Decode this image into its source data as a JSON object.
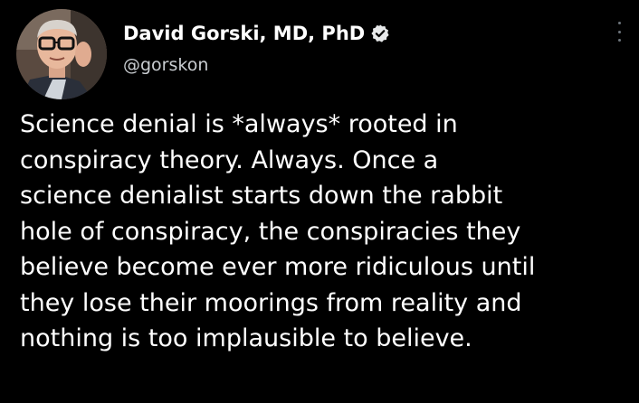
{
  "author": {
    "display_name": "David Gorski, MD, PhD",
    "handle": "@gorskon",
    "verified_icon": "verified-badge-icon",
    "avatar_icon": "profile-photo"
  },
  "menu": {
    "more_icon": "more-vertical-icon"
  },
  "tweet": {
    "lines": [
      "Science denial is *always* rooted in",
      "conspiracy theory. Always. Once a",
      "science denialist starts down the rabbit",
      "hole of conspiracy, the conspiracies they",
      "believe become ever more ridiculous until",
      "they lose their moorings from reality and",
      "nothing is too implausible to believe."
    ]
  },
  "colors": {
    "background": "#000000",
    "text": "#ffffff",
    "secondary_text": "#c9cdd1",
    "verified_badge": "#e7e9ea"
  }
}
